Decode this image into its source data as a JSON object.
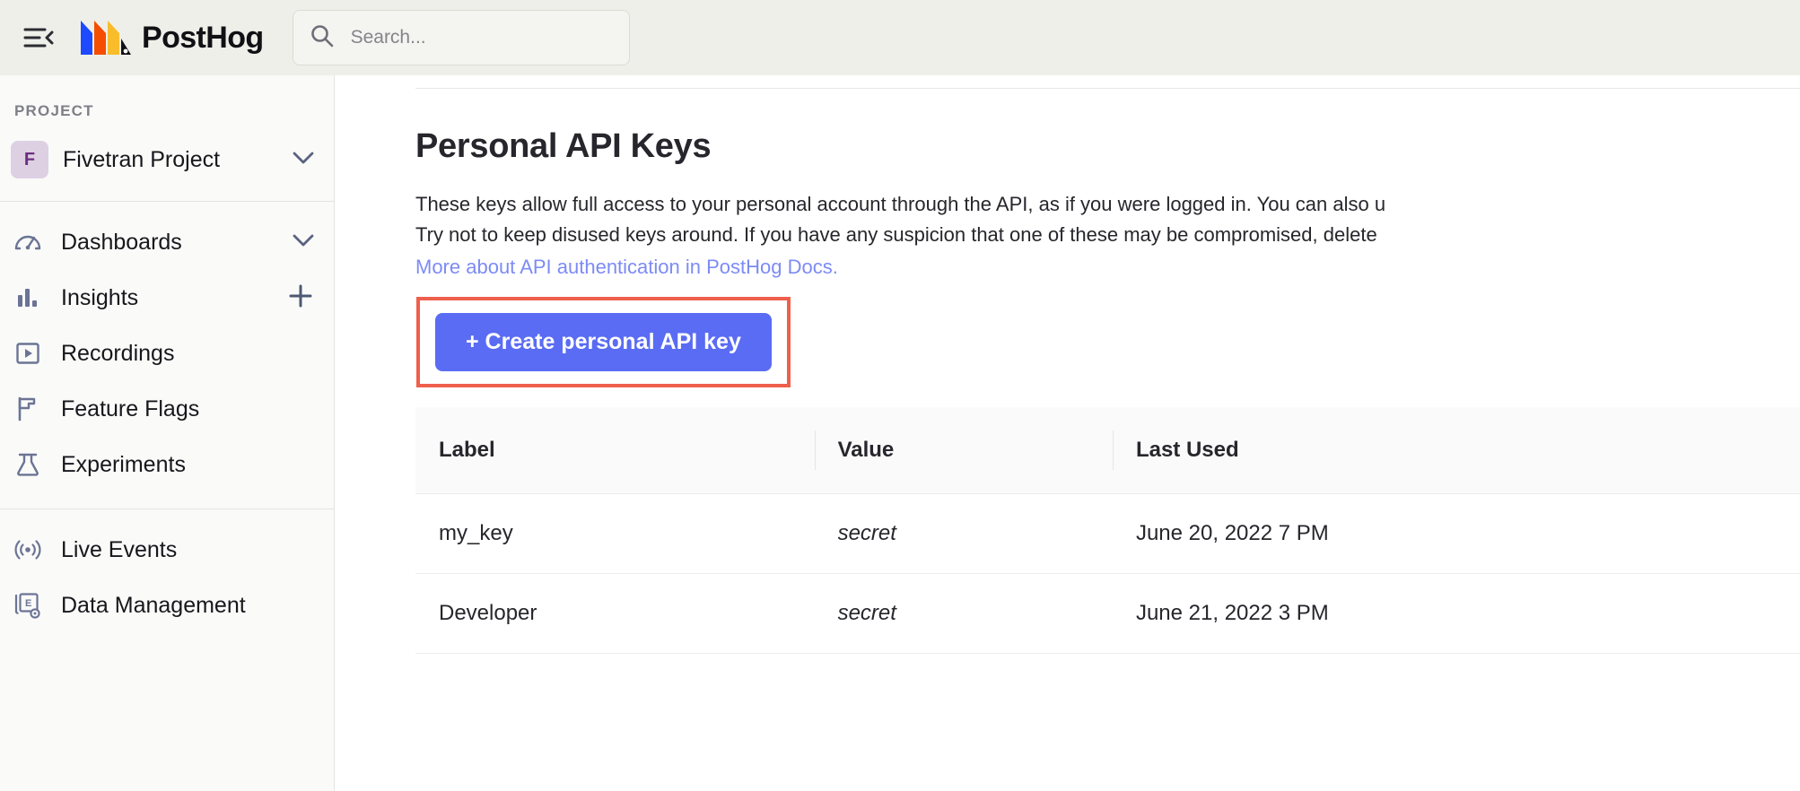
{
  "topbar": {
    "menu_icon": "hamburger-collapse-icon",
    "brand_name": "PostHog",
    "brand_logo_icon": "posthog-logo-icon",
    "search": {
      "icon": "search-icon",
      "placeholder": "Search...",
      "value": ""
    }
  },
  "sidebar": {
    "section_label": "PROJECT",
    "project": {
      "badge": "F",
      "name": "Fivetran Project",
      "caret_icon": "chevron-down-icon"
    },
    "items": [
      {
        "label": "Dashboards",
        "icon": "gauge-icon",
        "action": "chevron-down-icon"
      },
      {
        "label": "Insights",
        "icon": "bar-chart-icon",
        "action": "plus-icon"
      },
      {
        "label": "Recordings",
        "icon": "play-square-icon",
        "action": ""
      },
      {
        "label": "Feature Flags",
        "icon": "flag-icon",
        "action": ""
      },
      {
        "label": "Experiments",
        "icon": "flask-icon",
        "action": ""
      }
    ],
    "items_secondary": [
      {
        "label": "Live Events",
        "icon": "broadcast-icon",
        "action": ""
      },
      {
        "label": "Data Management",
        "icon": "data-management-icon",
        "action": ""
      }
    ]
  },
  "main": {
    "title": "Personal API Keys",
    "description_line1": "These keys allow full access to your personal account through the API, as if you were logged in. You can also u",
    "description_line2": "Try not to keep disused keys around. If you have any suspicion that one of these may be compromised, delete",
    "docs_link": "More about API authentication in PostHog Docs.",
    "create_button": "+ Create personal API key",
    "accent_color": "#5a6cf3",
    "annotation_color": "#ee5f4c",
    "link_color": "#7d8bf5",
    "table": {
      "columns": [
        "Label",
        "Value",
        "Last Used"
      ],
      "rows": [
        {
          "label": "my_key",
          "value": "secret",
          "last_used": "June 20, 2022 7 PM"
        },
        {
          "label": "Developer",
          "value": "secret",
          "last_used": "June 21, 2022 3 PM"
        }
      ]
    }
  }
}
